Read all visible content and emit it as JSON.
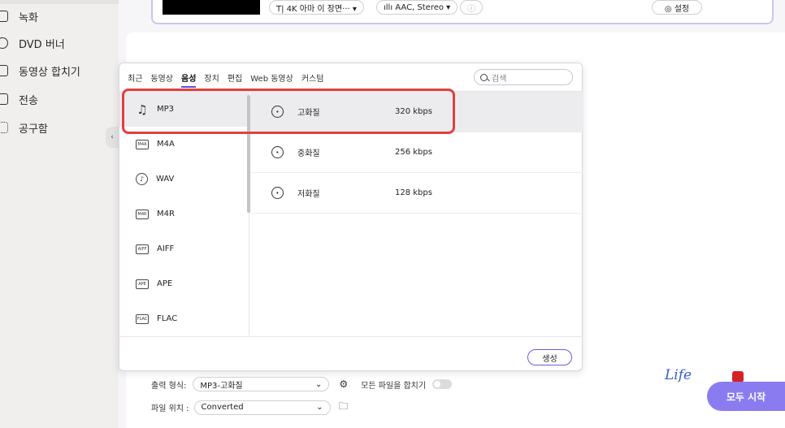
{
  "sidebar": {
    "items": [
      {
        "label": "녹화",
        "icon": "record-icon"
      },
      {
        "label": "DVD 버너",
        "icon": "dvd-icon"
      },
      {
        "label": "동영상 합치기",
        "icon": "merge-icon"
      },
      {
        "label": "전송",
        "icon": "transfer-icon"
      },
      {
        "label": "공구함",
        "icon": "toolbox-icon"
      }
    ],
    "collapse_glyph": "‹"
  },
  "task": {
    "subtitle_chip": "T|  4K 아마 이 장면··· ▾",
    "audio_chip": "ıllı  AAC, Stereo   ▾",
    "info_chip": "ⓘ",
    "settings_label": "◎ 설정"
  },
  "popup": {
    "tabs": [
      "최근",
      "동영상",
      "음성",
      "장치",
      "편집",
      "Web 동영상",
      "커스텀"
    ],
    "active_tab_index": 2,
    "search_placeholder": "검색",
    "formats": [
      {
        "label": "MP3",
        "icon": "music-note-icon",
        "glyph": "♫"
      },
      {
        "label": "M4A",
        "icon": "m4a-file-icon",
        "glyph": "M4A"
      },
      {
        "label": "WAV",
        "icon": "wav-icon",
        "glyph": "♪"
      },
      {
        "label": "M4R",
        "icon": "m4r-file-icon",
        "glyph": "M4R"
      },
      {
        "label": "AIFF",
        "icon": "aiff-file-icon",
        "glyph": "AIFF"
      },
      {
        "label": "APE",
        "icon": "ape-file-icon",
        "glyph": "APE"
      },
      {
        "label": "FLAC",
        "icon": "flac-file-icon",
        "glyph": "FLAC"
      }
    ],
    "selected_format_index": 0,
    "qualities": [
      {
        "name": "고화질",
        "rate": "320 kbps"
      },
      {
        "name": "중화질",
        "rate": "256 kbps"
      },
      {
        "name": "저화질",
        "rate": "128 kbps"
      }
    ],
    "selected_quality_index": 0,
    "create_label": "생성"
  },
  "bottom": {
    "output_label": "출력 형식:",
    "output_value": "MP3-고화질",
    "merge_label": "모든 파일을 합치기",
    "location_label": "파일 위치 :",
    "location_value": "Converted",
    "start_label": "모두 시작",
    "watermark_text": "Life"
  },
  "colors": {
    "accent": "#6a5ed8",
    "highlight_red": "#e0403f",
    "start_button": "#8a7cf0"
  }
}
